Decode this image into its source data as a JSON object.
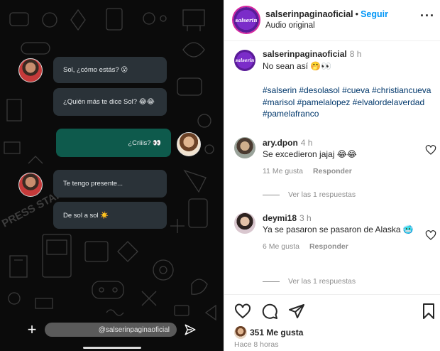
{
  "video": {
    "messages": [
      {
        "text": "Sol, ¿cómo estás? 😮",
        "direction": "incoming"
      },
      {
        "text": "¿Quién más te dice Sol? 😂😂",
        "direction": "incoming"
      },
      {
        "text": "¿Criiis? 👀",
        "direction": "outgoing"
      },
      {
        "text": "Te tengo presente...",
        "direction": "incoming"
      },
      {
        "text": "De sol a sol ☀️",
        "direction": "incoming"
      }
    ],
    "composer_handle": "@salserinpaginaoficial",
    "doodle_text": "PRESS START",
    "colors": {
      "background": "#0b0b0b",
      "incoming_bubble": "#2a3238",
      "outgoing_bubble": "#0e5a4c"
    }
  },
  "header": {
    "username": "salserinpaginaoficial",
    "separator": "•",
    "follow_label": "Seguir",
    "audio_label": "Audio original",
    "more_icon": "more-horizontal-icon",
    "avatar_text": "salserin"
  },
  "caption": {
    "username": "salserinpaginaoficial",
    "time": "8 h",
    "text": "No sean así 🤭👀",
    "hashtags": "#salserin #desolasol #cueva #christiancueva #marisol #pamelalopez #elvalordelaverdad #pamelafranco"
  },
  "comments": [
    {
      "username": "ary.dpon",
      "time": "4 h",
      "text": "Se excedieron jajaj 😂😂",
      "likes": "11 Me gusta",
      "reply_label": "Responder",
      "view_replies": "Ver las 1 respuestas"
    },
    {
      "username": "deymi18",
      "time": "3 h",
      "text": "Ya se pasaron se pasaron de Alaska 🥶",
      "likes": "6 Me gusta",
      "reply_label": "Responder",
      "view_replies": "Ver las 1 respuestas"
    }
  ],
  "footer": {
    "like_count": "351 Me gusta",
    "posted_ago": "Hace 8 horas"
  },
  "colors": {
    "link_blue": "#0095f6",
    "hashtag": "#00376b",
    "muted": "#8e8e8e",
    "avatar_purple": "#7b2cc9"
  }
}
